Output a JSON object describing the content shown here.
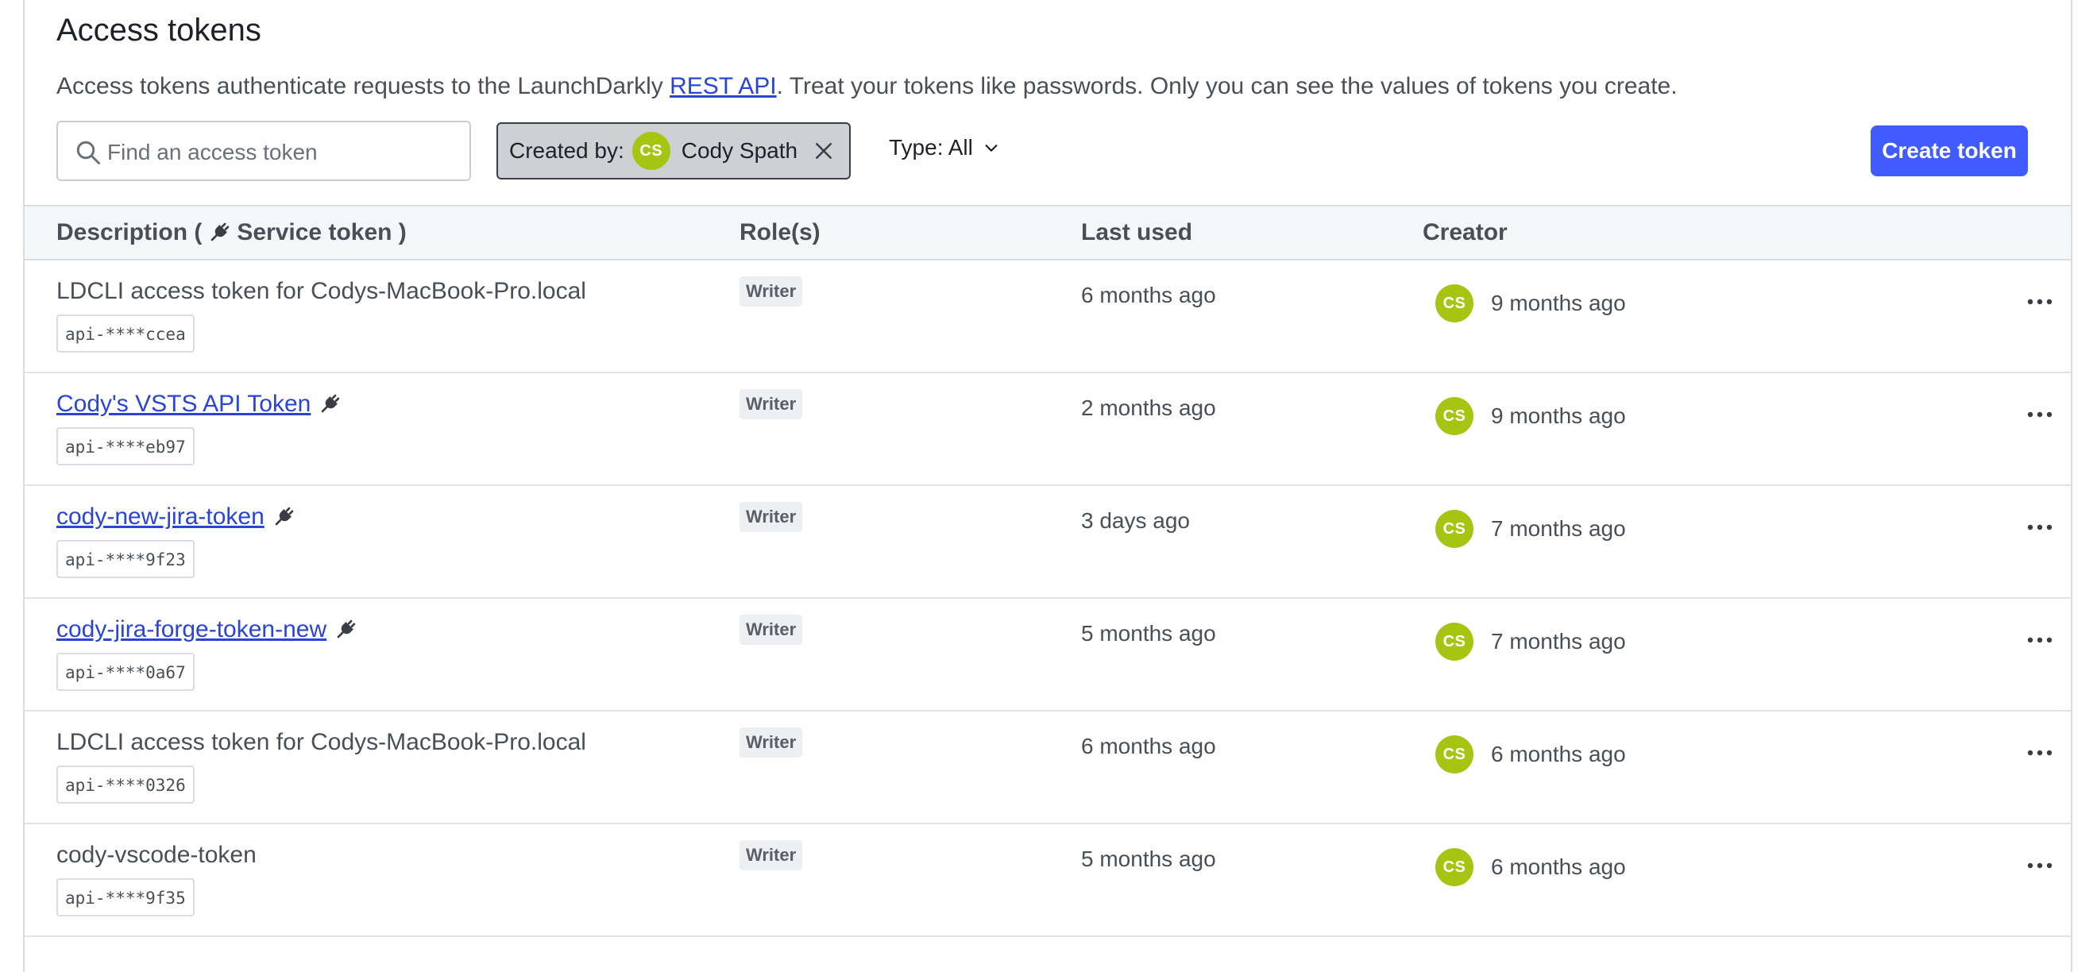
{
  "page": {
    "title": "Access tokens",
    "description_before": "Access tokens authenticate requests to the LaunchDarkly ",
    "description_link": "REST API",
    "description_after": ". Treat your tokens like passwords. Only you can see the values of tokens you create."
  },
  "toolbar": {
    "search_placeholder": "Find an access token",
    "search_value": "",
    "filter_created_by_label": "Created by:",
    "filter_created_by_initials": "CS",
    "filter_created_by_name": "Cody Spath",
    "type_filter_label": "Type: All",
    "create_button_label": "Create token"
  },
  "table": {
    "headers": {
      "description_prefix": "Description (",
      "description_suffix": " Service token )",
      "roles": "Role(s)",
      "last_used": "Last used",
      "creator": "Creator"
    },
    "rows": [
      {
        "name": "LDCLI access token for Codys-MacBook-Pro.local",
        "service": false,
        "key": "api-****ccea",
        "role": "Writer",
        "last_used": "6 months ago",
        "creator_initials": "CS",
        "created": "9 months ago"
      },
      {
        "name": "Cody's VSTS API Token",
        "service": true,
        "key": "api-****eb97",
        "role": "Writer",
        "last_used": "2 months ago",
        "creator_initials": "CS",
        "created": "9 months ago"
      },
      {
        "name": "cody-new-jira-token",
        "service": true,
        "key": "api-****9f23",
        "role": "Writer",
        "last_used": "3 days ago",
        "creator_initials": "CS",
        "created": "7 months ago"
      },
      {
        "name": "cody-jira-forge-token-new",
        "service": true,
        "key": "api-****0a67",
        "role": "Writer",
        "last_used": "5 months ago",
        "creator_initials": "CS",
        "created": "7 months ago"
      },
      {
        "name": "LDCLI access token for Codys-MacBook-Pro.local",
        "service": false,
        "key": "api-****0326",
        "role": "Writer",
        "last_used": "6 months ago",
        "creator_initials": "CS",
        "created": "6 months ago"
      },
      {
        "name": "cody-vscode-token",
        "service": false,
        "key": "api-****9f35",
        "role": "Writer",
        "last_used": "5 months ago",
        "creator_initials": "CS",
        "created": "6 months ago"
      }
    ]
  },
  "colors": {
    "accent": "#405bff",
    "link": "#2944d6",
    "avatar": "#a6c512"
  },
  "icons": {
    "search": "search-icon",
    "close": "close-icon",
    "chevron": "chevron-down-icon",
    "service_token": "plug-icon",
    "more": "more-horizontal-icon"
  }
}
